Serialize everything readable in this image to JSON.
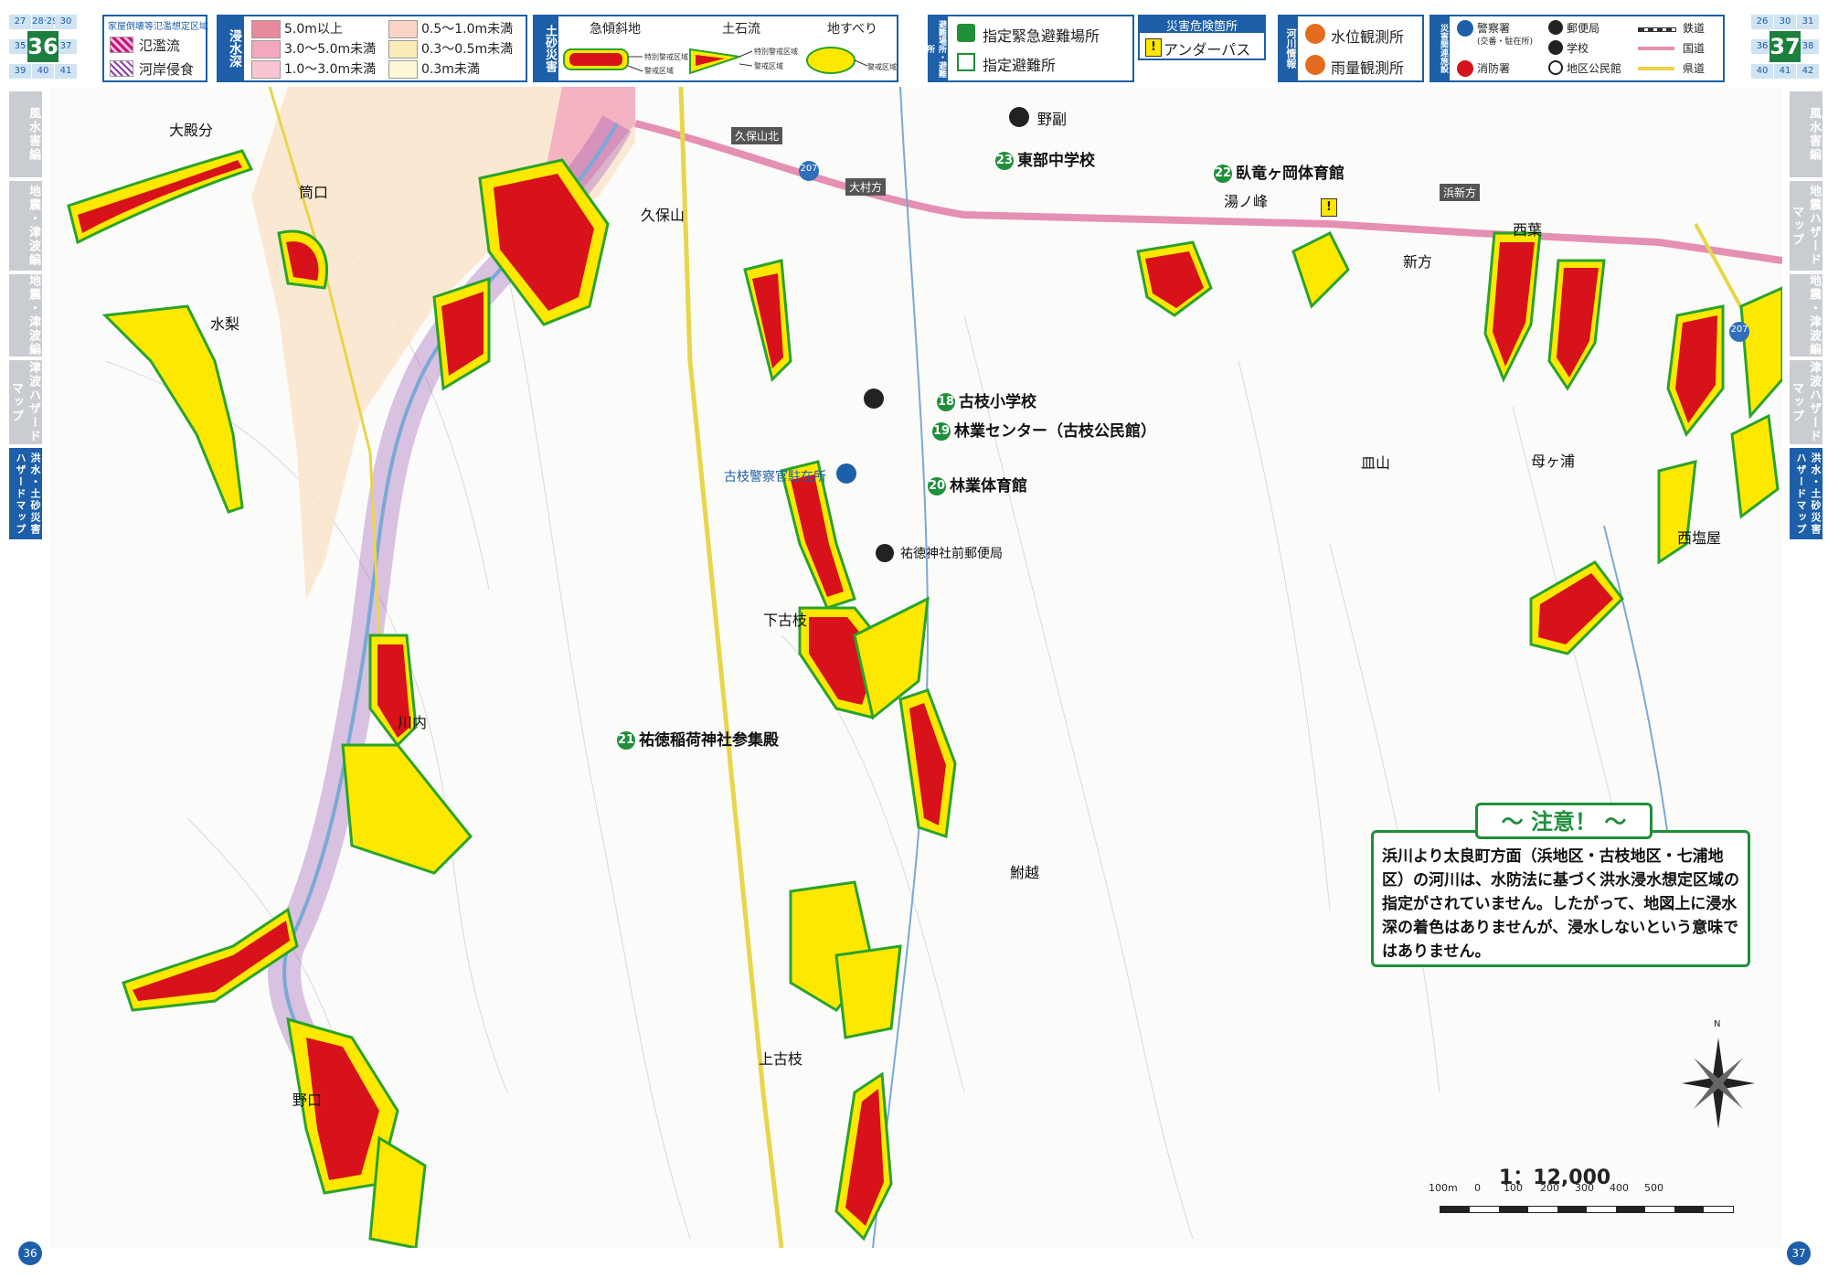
{
  "pages": {
    "left": "36",
    "right": "37"
  },
  "page_nav": {
    "left": {
      "cells": [
        "27",
        "28·29",
        "30",
        "35",
        "37",
        "39",
        "40",
        "41"
      ],
      "current": "36"
    },
    "right": {
      "cells": [
        "26",
        "30",
        "31",
        "36",
        "38",
        "40",
        "41",
        "42"
      ],
      "current": "37"
    }
  },
  "legend": {
    "flood_area_title": "家屋倒壊等氾濫想定区域",
    "flood_area_items": [
      "氾濫流",
      "河岸侵食"
    ],
    "depth_label": "浸水深",
    "depth_items": [
      {
        "label": "5.0m以上",
        "color": "#e8899d"
      },
      {
        "label": "3.0～5.0m未満",
        "color": "#f2a9bd"
      },
      {
        "label": "1.0～3.0m未満",
        "color": "#f7c6d2"
      },
      {
        "label": "0.5～1.0m未満",
        "color": "#f9d3c6"
      },
      {
        "label": "0.3～0.5m未満",
        "color": "#fbecb8"
      },
      {
        "label": "0.3m未満",
        "color": "#fdf7d6"
      }
    ],
    "sediment_label": "土砂災害",
    "sediment_cols": [
      "急傾斜地",
      "土石流",
      "地すべり"
    ],
    "sediment_notes": [
      "特別警戒区域",
      "警戒区域",
      "特別警戒区域",
      "警戒区域",
      "警戒区域"
    ],
    "evac_label": "避難場所・避難所",
    "evac_items": [
      "指定緊急避難場所",
      "指定避難所"
    ],
    "danger_title": "災害危険箇所",
    "danger_items": [
      "アンダーパス"
    ],
    "river_label": "河川情報",
    "river_items": [
      "水位観測所",
      "雨量観測所"
    ],
    "disaster_label": "災害関連施設",
    "facility_items": [
      "警察署",
      "(交番・駐在所)",
      "消防署",
      "郵便局",
      "学校",
      "地区公民館"
    ],
    "line_items": [
      "鉄道",
      "国道",
      "県道"
    ]
  },
  "side_tabs": {
    "left": [
      "風水害編",
      "地震・津波編",
      "地震・津波編",
      "津波ハザードマップ",
      "洪水・土砂災害ハザードマップ"
    ],
    "right": [
      "風水害編",
      "地震ハザードマップ",
      "地震・津波編",
      "津波ハザードマップ",
      "洪水・土砂災害ハザードマップ"
    ]
  },
  "places": [
    "大殿分",
    "筒口",
    "水梨",
    "久保山",
    "野副",
    "湯ノ峰",
    "新方",
    "西葉",
    "皿山",
    "母ヶ浦",
    "西塩屋",
    "下古枝",
    "川内",
    "鮒越",
    "上古枝",
    "野口",
    "久保山北",
    "大村方",
    "浜新方"
  ],
  "facilities": [
    {
      "num": "23",
      "name": "東部中学校"
    },
    {
      "num": "22",
      "name": "臥竜ヶ岡体育館"
    },
    {
      "num": "18",
      "name": "古枝小学校"
    },
    {
      "num": "19",
      "name": "林業センター（古枝公民館）"
    },
    {
      "num": "20",
      "name": "林業体育館"
    },
    {
      "num": "21",
      "name": "祐徳稲荷神社参集殿"
    },
    {
      "num": "",
      "name": "祐徳神社前郵便局"
    },
    {
      "num": "",
      "name": "古枝警察官駐在所"
    }
  ],
  "route_numbers": [
    "207",
    "207"
  ],
  "caution": {
    "title": "～ 注意！ ～",
    "text": "浜川より太良町方面（浜地区・古枝地区・七浦地区）の河川は、水防法に基づく洪水浸水想定区域の指定がされていません。したがって、地図上に浸水深の着色はありませんが、浸水しないという意味ではありません。"
  },
  "scale": {
    "label": "1：12,000",
    "ticks": [
      "100m",
      "0",
      "100",
      "200",
      "300",
      "400",
      "500"
    ]
  },
  "north": "N",
  "colors": {
    "accent": "#1d5fa8",
    "green": "#1f8f3a",
    "hazard_red": "#d7121b",
    "hazard_yellow": "#ffe800",
    "hazard_edge": "#2aa32a",
    "national_road": "#e58fb3",
    "pref_road": "#e8d54a"
  }
}
